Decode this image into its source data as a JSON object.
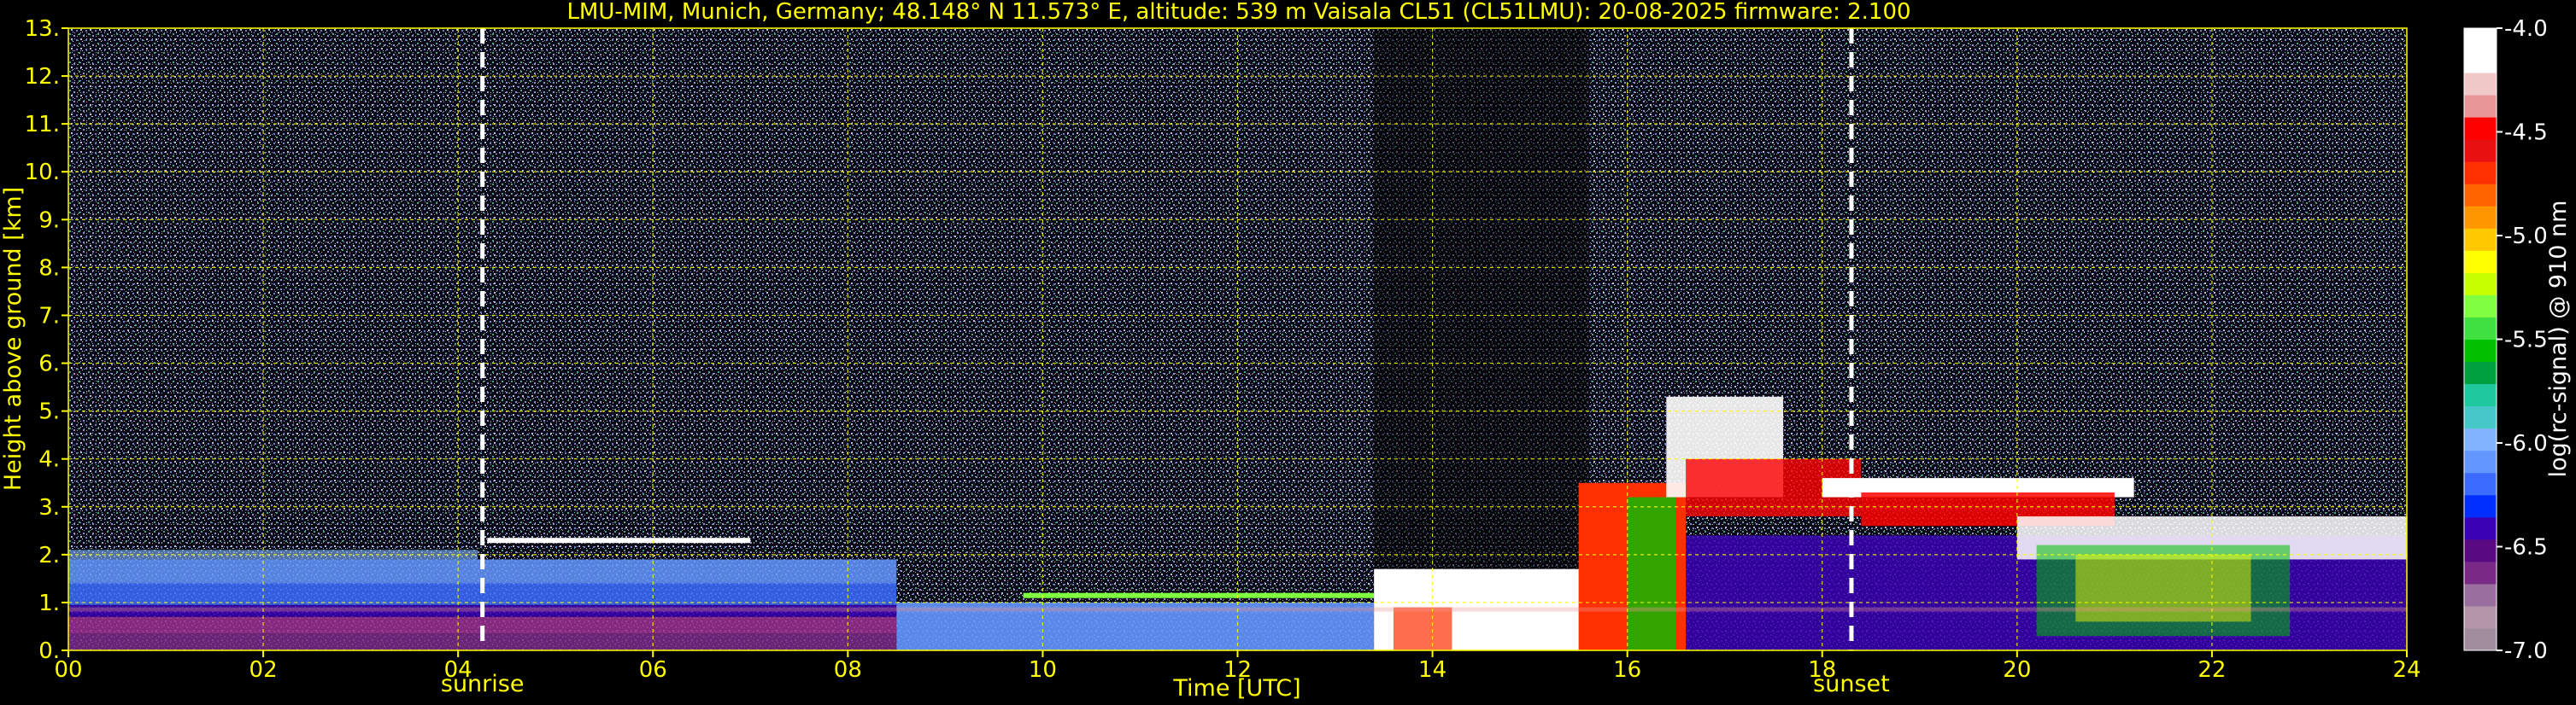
{
  "chart_data": {
    "type": "heatmap",
    "title": "LMU-MIM, Munich, Germany; 48.148° N 11.573° E, altitude: 539 m    Vaisala CL51 (CL51LMU): 20-08-2025    firmware: 2.100",
    "xlabel": "Time [UTC]",
    "ylabel": "Height above ground [km]",
    "colorbar_label": "log(rc-signal) @ 910 nm",
    "xlim": [
      0,
      24
    ],
    "ylim": [
      0,
      13
    ],
    "color_range": [
      -7.0,
      -4.0
    ],
    "grid": true,
    "x_ticks": [
      "00",
      "02",
      "04",
      "06",
      "08",
      "10",
      "12",
      "14",
      "16",
      "18",
      "20",
      "22",
      "24"
    ],
    "x_tick_values": [
      0,
      2,
      4,
      6,
      8,
      10,
      12,
      14,
      16,
      18,
      20,
      22,
      24
    ],
    "y_ticks": [
      "0.",
      "1.",
      "2.",
      "3.",
      "4.",
      "5.",
      "6.",
      "7.",
      "8.",
      "9.",
      "10.",
      "11.",
      "12.",
      "13."
    ],
    "y_tick_values": [
      0,
      1,
      2,
      3,
      4,
      5,
      6,
      7,
      8,
      9,
      10,
      11,
      12,
      13
    ],
    "colorbar_ticks": [
      "-4.0",
      "-4.5",
      "-5.0",
      "-5.5",
      "-6.0",
      "-6.5",
      "-7.0"
    ],
    "colorbar_tick_values": [
      -4.0,
      -4.5,
      -5.0,
      -5.5,
      -6.0,
      -6.5,
      -7.0
    ],
    "annotations": [
      {
        "label": "sunrise",
        "x": 4.25
      },
      {
        "label": "sunset",
        "x": 18.3
      }
    ],
    "colormap": [
      "#a08c9c",
      "#b496aa",
      "#9a6e9e",
      "#7a2a86",
      "#5a0a80",
      "#3a00b4",
      "#0030ff",
      "#3c6cff",
      "#6496ff",
      "#80b4ff",
      "#46c8c8",
      "#20c8a0",
      "#00a040",
      "#00c000",
      "#40e040",
      "#80ff40",
      "#c8ff00",
      "#ffff00",
      "#ffc800",
      "#ff9600",
      "#ff6400",
      "#ff3000",
      "#e81010",
      "#ff0000",
      "#e89696",
      "#f0c8c8",
      "#ffffff",
      "#ffffff"
    ]
  }
}
